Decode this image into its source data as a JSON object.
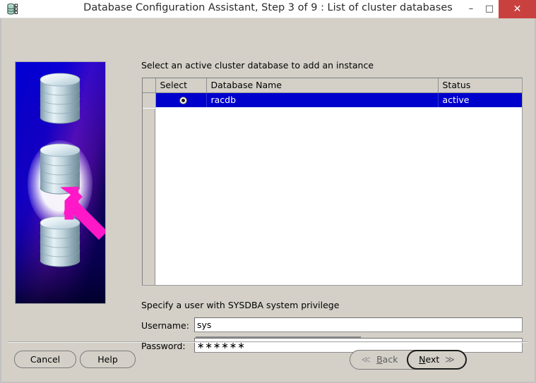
{
  "window": {
    "title": "Database Configuration Assistant, Step 3 of 9 : List of cluster databases",
    "icon": "database-app-icon",
    "controls": {
      "minimize": "–",
      "maximize": "□",
      "close": "✕"
    },
    "close_button_color": "#c9413f"
  },
  "sidebar": {
    "graphic_name": "cluster-databases-illustration",
    "background_gradient": [
      "#0000d2",
      "#8c24b4",
      "#000033"
    ],
    "arrow_color": "#ff18c8",
    "cylinder_color": "#c8dce6",
    "highlighted_index": 1,
    "cylinder_count": 3
  },
  "main": {
    "instruction": "Select an active cluster database to add an instance",
    "table": {
      "columns": [
        "Select",
        "Database Name",
        "Status"
      ],
      "rows": [
        {
          "selected": true,
          "radio": "radio-selected",
          "database_name": "racdb",
          "status": "active"
        }
      ],
      "selection_color": "#0000cd"
    },
    "credentials": {
      "section_label": "Specify a user with SYSDBA system privilege",
      "username_label": "Username:",
      "username_value": "sys",
      "username_placeholder": "",
      "password_label": "Password:",
      "password_value": "∗∗∗∗∗∗",
      "password_placeholder": ""
    }
  },
  "footer": {
    "cancel_label": "Cancel",
    "help_label": "Help",
    "back_label": "Back",
    "back_mnemonic": "B",
    "back_chevron": "≪",
    "back_enabled": false,
    "next_label": "Next",
    "next_mnemonic": "N",
    "next_chevron": "≫",
    "next_default": true
  }
}
